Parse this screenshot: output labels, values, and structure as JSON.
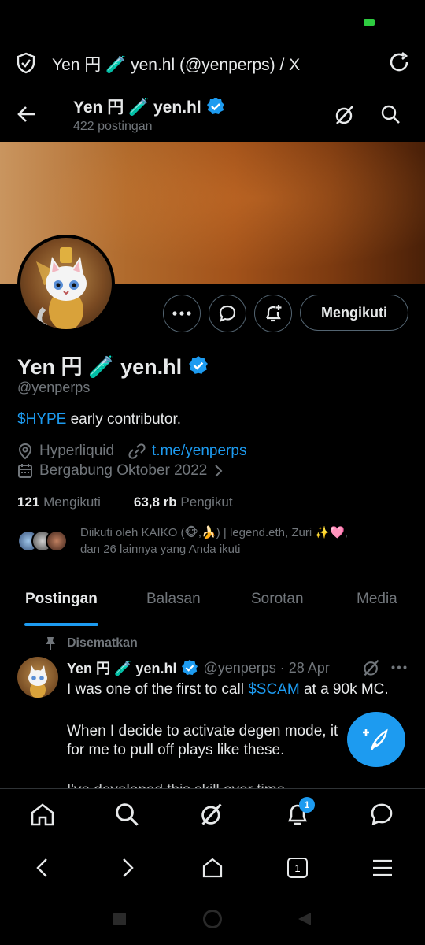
{
  "browser": {
    "title": "Yen 円 🧪 yen.hl (@yenperps) / X"
  },
  "header": {
    "name": "Yen 円 🧪 yen.hl",
    "posts_count": "422 postingan"
  },
  "profile": {
    "name": "Yen 円 🧪 yen.hl",
    "handle": "@yenperps",
    "bio_cashtag": "$HYPE",
    "bio_rest": " early contributor.",
    "location": "Hyperliquid",
    "website": "t.me/yenperps",
    "joined": "Bergabung Oktober 2022",
    "following_count": "121",
    "following_label": "Mengikuti",
    "followers_count": "63,8 rb",
    "followers_label": "Pengikut",
    "followed_by_line1": "Diikuti oleh KAIKO (🐵,🍌) | legend.eth, Zuri ✨🩷,",
    "followed_by_line2": "dan 26 lainnya yang Anda ikuti",
    "follow_button": "Mengikuti"
  },
  "tabs": [
    {
      "label": "Postingan"
    },
    {
      "label": "Balasan"
    },
    {
      "label": "Sorotan"
    },
    {
      "label": "Media"
    }
  ],
  "pinned_post": {
    "pinned_label": "Disematkan",
    "author": "Yen 円 🧪 yen.hl",
    "meta": "@yenperps · 28 Apr",
    "line1_pre": "I was one of the first to call ",
    "line1_cashtag": "$SCAM",
    "line1_post": " at a 90k MC.",
    "line2": "When I decide to activate degen mode, it",
    "line3": "for me to pull off plays like these.",
    "line4": "I've developed this skill over time"
  },
  "bottom_nav": {
    "notifications_badge": "1"
  },
  "browser_nav": {
    "tabs_count": "1"
  },
  "colors": {
    "accent": "#1d9bf0",
    "background": "#000000",
    "text_secondary": "#71767b"
  }
}
